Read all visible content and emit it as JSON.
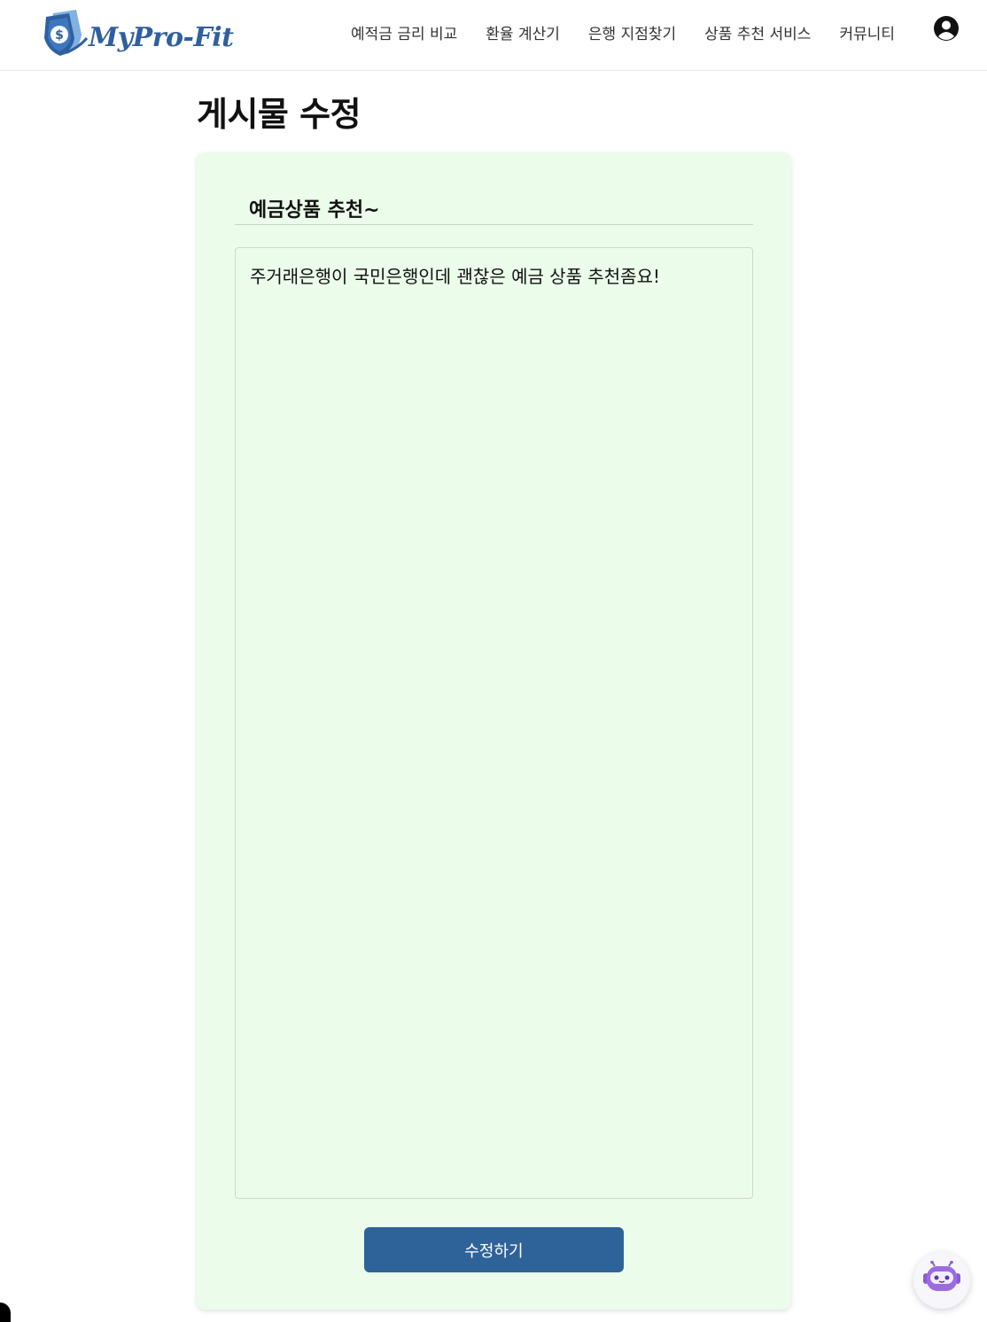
{
  "header": {
    "logo_text": "MyPro-Fit",
    "nav": [
      {
        "label": "예적금 금리 비교"
      },
      {
        "label": "환율 계산기"
      },
      {
        "label": "은행 지점찾기"
      },
      {
        "label": "상품 추천 서비스"
      },
      {
        "label": "커뮤니티"
      }
    ],
    "profile_icon": "user-circle-icon"
  },
  "page": {
    "title": "게시물 수정"
  },
  "form": {
    "title_value": "예금상품 추천~",
    "content_value": "주거래은행이 국민은행인데 괜찮은 예금 상품 추천좀요!",
    "submit_label": "수정하기"
  },
  "colors": {
    "card_bg": "#ebfdea",
    "button_bg": "#2e6399",
    "logo_blue": "#2f5fa0"
  },
  "chatbot": {
    "icon": "robot-icon"
  }
}
